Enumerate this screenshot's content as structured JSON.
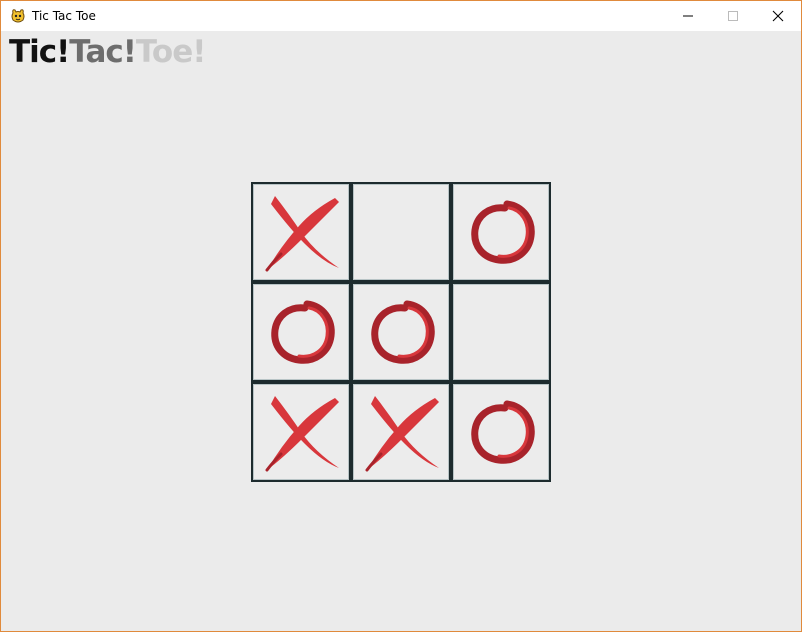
{
  "window": {
    "title": "Tic Tac Toe",
    "app_icon": "pygame-snake-icon",
    "controls": [
      "minimize-icon",
      "maximize-icon",
      "close-icon"
    ]
  },
  "logo": {
    "word1": "Tic!",
    "word2": "Tac!",
    "word3": "Toe!"
  },
  "board": {
    "cells": [
      [
        "X",
        "",
        "O"
      ],
      [
        "O",
        "O",
        ""
      ],
      [
        "X",
        "X",
        "O"
      ]
    ]
  },
  "colors": {
    "mark_red": "#d8373c",
    "mark_dark_red": "#a8232b",
    "grid_line": "#1d2b2e",
    "background": "#ebebeb",
    "window_border": "#e08a3c"
  }
}
